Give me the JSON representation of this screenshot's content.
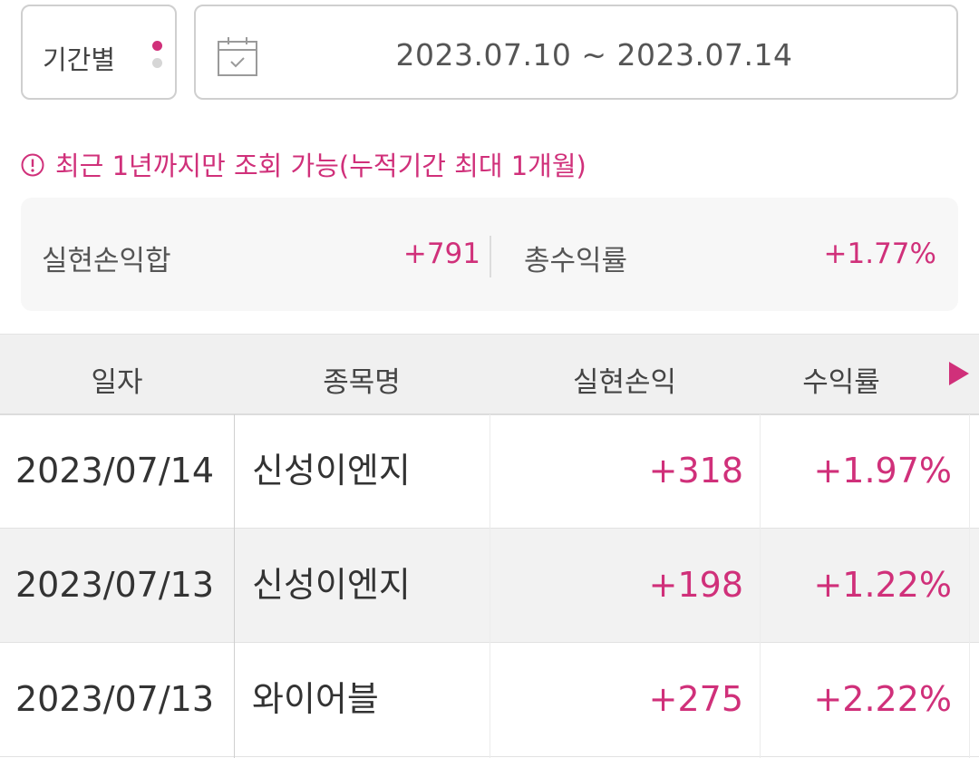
{
  "colors": {
    "accent": "#d0307a"
  },
  "filter": {
    "period_label": "기간별",
    "date_range": "2023.07.10 ~ 2023.07.14",
    "calendar_icon": "calendar-check-icon"
  },
  "notice": {
    "icon": "info-circle-icon",
    "text": "최근 1년까지만 조회 가능(누적기간 최대 1개월)"
  },
  "summary": {
    "realized_pnl_label": "실현손익합",
    "realized_pnl_value": "+791",
    "total_return_label": "총수익률",
    "total_return_value": "+1.77%"
  },
  "table": {
    "headers": [
      "일자",
      "종목명",
      "실현손익",
      "수익률"
    ],
    "scroll_icon": "triangle-right-icon",
    "rows": [
      {
        "date": "2023/07/14",
        "name": "신성이엔지",
        "pnl": "+318",
        "rate": "+1.97%"
      },
      {
        "date": "2023/07/13",
        "name": "신성이엔지",
        "pnl": "+198",
        "rate": "+1.22%"
      },
      {
        "date": "2023/07/13",
        "name": "와이어블",
        "pnl": "+275",
        "rate": "+2.22%"
      }
    ]
  }
}
